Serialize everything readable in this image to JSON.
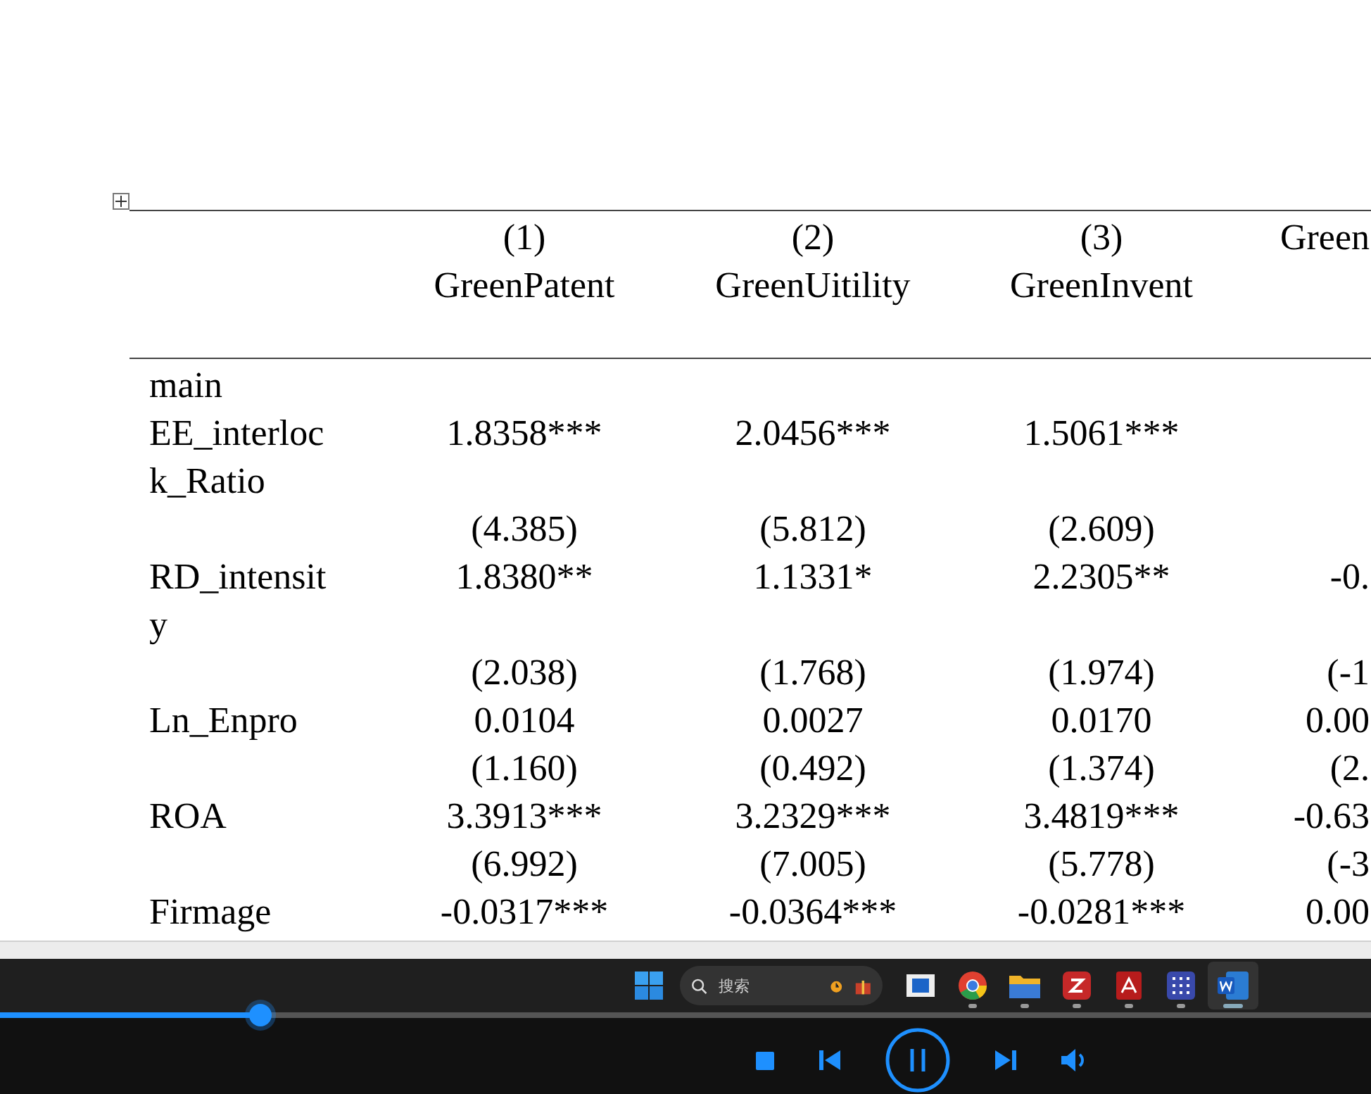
{
  "document": {
    "table": {
      "columns": [
        {
          "number": "(1)",
          "name": "GreenPatent"
        },
        {
          "number": "(2)",
          "name": "GreenUitility"
        },
        {
          "number": "(3)",
          "name": "GreenInvent"
        },
        {
          "name": "Green"
        }
      ],
      "rows": [
        {
          "label": "main",
          "cells": []
        },
        {
          "label": "EE_interlock_Ratio",
          "cells": [
            "1.8358***",
            "2.0456***",
            "1.5061***"
          ]
        },
        {
          "cells": [
            "(4.385)",
            "(5.812)",
            "(2.609)"
          ]
        },
        {
          "label": "RD_intensity",
          "cells": [
            "1.8380**",
            "1.1331*",
            "2.2305**",
            "-0."
          ]
        },
        {
          "cells": [
            "(2.038)",
            "(1.768)",
            "(1.974)",
            "(-1"
          ]
        },
        {
          "label": "Ln_Enpro",
          "cells": [
            "0.0104",
            "0.0027",
            "0.0170",
            "0.00"
          ]
        },
        {
          "cells": [
            "(1.160)",
            "(0.492)",
            "(1.374)",
            "(2."
          ]
        },
        {
          "label": "ROA",
          "cells": [
            "3.3913***",
            "3.2329***",
            "3.4819***",
            "-0.63"
          ]
        },
        {
          "cells": [
            "(6.992)",
            "(7.005)",
            "(5.778)",
            "(-3"
          ]
        },
        {
          "label": "Firmage",
          "cells": [
            "-0.0317***",
            "-0.0364***",
            "-0.0281***",
            "0.00"
          ]
        }
      ]
    }
  },
  "taskbar": {
    "search": {
      "placeholder": "搜索"
    },
    "apps": [
      {
        "kind": "film",
        "running": false,
        "selected": false
      },
      {
        "kind": "browser",
        "running": true,
        "selected": false
      },
      {
        "kind": "folder",
        "running": true,
        "selected": false
      },
      {
        "kind": "z",
        "running": true,
        "selected": false
      },
      {
        "kind": "pdf",
        "running": true,
        "selected": false
      },
      {
        "kind": "grid",
        "running": true,
        "selected": false
      },
      {
        "kind": "word",
        "running": true,
        "selected": true
      }
    ]
  },
  "player": {
    "progress": {
      "level": 0.19
    },
    "playing": true
  }
}
